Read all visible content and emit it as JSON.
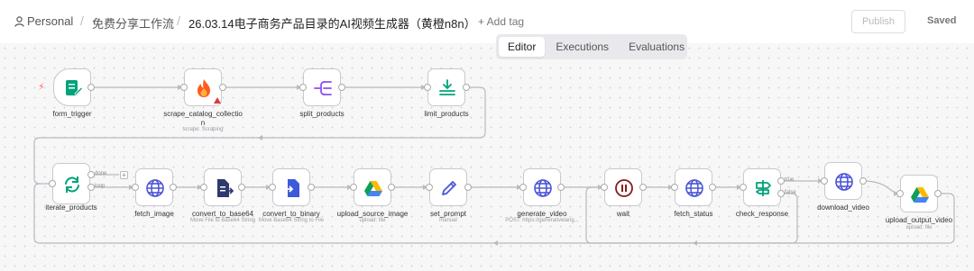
{
  "header": {
    "breadcrumb_personal": "Personal",
    "breadcrumb_folder": "免费分享工作流",
    "title": "26.03.14电子商务产品目录的AI视频生成器（黄橙n8n）",
    "add_tag": "+ Add tag",
    "publish": "Publish",
    "saved": "Saved"
  },
  "tabs": [
    "Editor",
    "Executions",
    "Evaluations"
  ],
  "active_tab": "Editor",
  "nodes": [
    {
      "id": "form_trigger",
      "label": "form_trigger",
      "subtitle": "",
      "icon": "form-icon",
      "color": "#00a37a"
    },
    {
      "id": "scrape_catalog_collection",
      "label": "scrape_catalog_collectio",
      "label2": "n",
      "subtitle": "scrape: Scraping",
      "icon": "flame-icon",
      "color": "#ff5a1f"
    },
    {
      "id": "split_products",
      "label": "split_products",
      "subtitle": "",
      "icon": "split-icon",
      "color": "#8e4ff0"
    },
    {
      "id": "limit_products",
      "label": "limit_products",
      "subtitle": "",
      "icon": "limit-icon",
      "color": "#00a37a"
    },
    {
      "id": "iterate_products",
      "label": "iterate_products",
      "subtitle": "",
      "icon": "loop-icon",
      "color": "#00a37a"
    },
    {
      "id": "fetch_image",
      "label": "fetch_image",
      "subtitle": "",
      "icon": "globe-icon",
      "color": "#4b55d6"
    },
    {
      "id": "convert_to_base64",
      "label": "convert_to_base64",
      "subtitle": "Move File to Base64 String",
      "icon": "file-export-icon",
      "color": "#2e3a6e"
    },
    {
      "id": "convert_to_binary",
      "label": "convert_to_binary",
      "subtitle": "Move Base64 String to File",
      "icon": "file-import-icon",
      "color": "#3b5bdb"
    },
    {
      "id": "upload_source_image",
      "label": "upload_source_image",
      "subtitle": "upload: file",
      "icon": "google-drive-icon",
      "color": "#1fa463"
    },
    {
      "id": "set_prompt",
      "label": "set_prompt",
      "subtitle": "manual",
      "icon": "pencil-icon",
      "color": "#4b55d6"
    },
    {
      "id": "generate_video",
      "label": "generate_video",
      "subtitle": "POST: https://generativelang...",
      "icon": "globe-icon",
      "color": "#4b55d6"
    },
    {
      "id": "wait",
      "label": "wait",
      "subtitle": "",
      "icon": "pause-icon",
      "color": "#8b1a1a"
    },
    {
      "id": "fetch_status",
      "label": "fetch_status",
      "subtitle": "",
      "icon": "globe-icon",
      "color": "#4b55d6"
    },
    {
      "id": "check_response",
      "label": "check_response",
      "subtitle": "",
      "icon": "signpost-icon",
      "color": "#00a37a"
    },
    {
      "id": "download_video",
      "label": "download_video",
      "subtitle": "",
      "icon": "globe-icon",
      "color": "#4b55d6"
    },
    {
      "id": "upload_output_video",
      "label": "upload_output_video",
      "subtitle": "upload: file",
      "icon": "google-drive-icon",
      "color": "#1fa463"
    }
  ],
  "branch_labels": {
    "done": "done",
    "loop": "loop",
    "true": "true",
    "false": "false"
  },
  "colors": {
    "accent": "#ff6d5a",
    "edge": "#b9b9bf",
    "canvas": "#f7f7f8"
  }
}
